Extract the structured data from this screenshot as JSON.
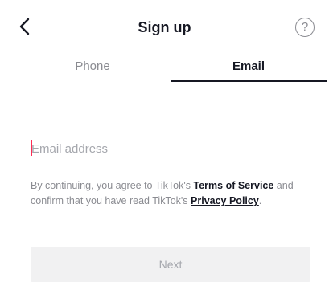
{
  "header": {
    "title": "Sign up",
    "back_icon": "chevron-left-icon",
    "help_icon": "question-circle-icon",
    "help_glyph": "?"
  },
  "tabs": [
    {
      "label": "Phone",
      "active": false
    },
    {
      "label": "Email",
      "active": true
    }
  ],
  "email": {
    "value": "",
    "placeholder": "Email address"
  },
  "terms": {
    "prefix": "By continuing, you agree to TikTok's ",
    "terms_link": "Terms of Service",
    "middle": " and confirm that you have read TikTok's ",
    "privacy_link": "Privacy Policy",
    "suffix": "."
  },
  "next_button": {
    "label": "Next",
    "enabled": false
  },
  "colors": {
    "accent": "#fe2c55",
    "text_primary": "#161823",
    "text_secondary": "#8a8b91",
    "button_disabled_bg": "#f1f1f2"
  }
}
